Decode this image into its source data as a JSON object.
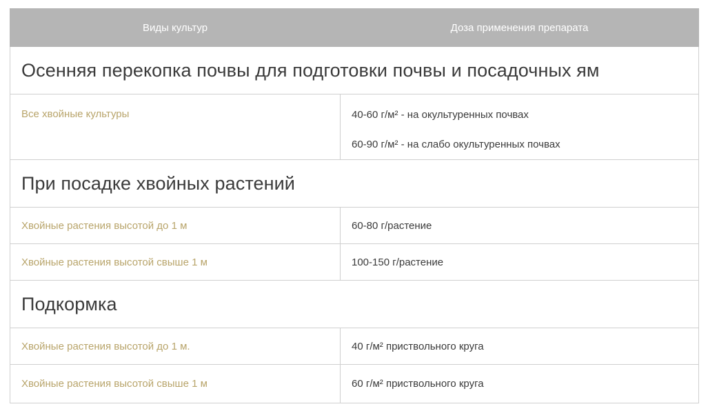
{
  "table": {
    "headers": {
      "crops": "Виды культур",
      "dose": "Доза применения препарата"
    },
    "sections": [
      {
        "title": "Осенняя перекопка почвы для подготовки почвы и посадочных ям",
        "rows": [
          {
            "crop": "Все хвойные культуры",
            "dose": [
              "40-60 г/м² - на окультуренных почвах",
              "60-90 г/м² - на слабо окультуренных почвах"
            ]
          }
        ]
      },
      {
        "title": "При посадке хвойных растений",
        "rows": [
          {
            "crop": "Хвойные растения высотой до 1 м",
            "dose": [
              "60-80 г/растение"
            ]
          },
          {
            "crop": "Хвойные растения высотой свыше 1 м",
            "dose": [
              "100-150 г/растение"
            ]
          }
        ]
      },
      {
        "title": "Подкормка",
        "rows": [
          {
            "crop": "Хвойные растения высотой до 1 м.",
            "dose": [
              "40 г/м² приствольного круга"
            ]
          },
          {
            "crop": "Хвойные растения высотой свыше 1 м",
            "dose": [
              "60 г/м² приствольного круга"
            ]
          }
        ]
      }
    ]
  },
  "colors": {
    "header_bg": "#b5b5b5",
    "crop_text": "#b8a46a",
    "body_text": "#3a3a3a",
    "border": "#cfcfcf"
  }
}
